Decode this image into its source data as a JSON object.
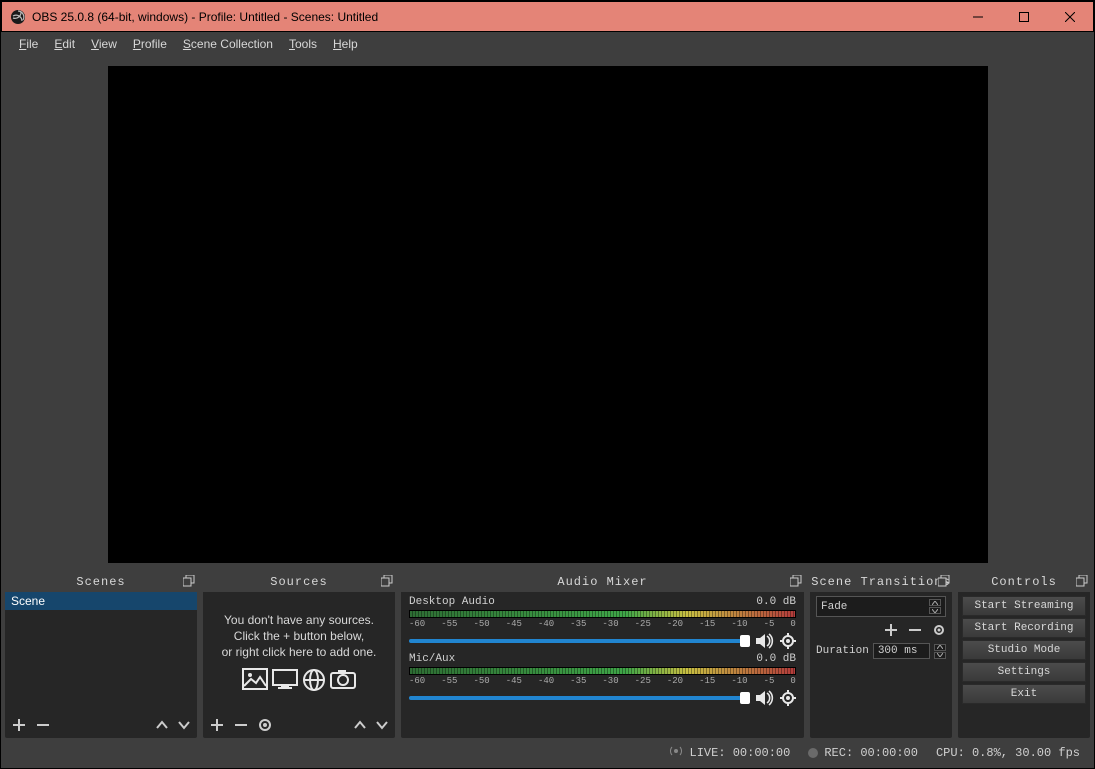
{
  "window": {
    "title": "OBS 25.0.8 (64-bit, windows) - Profile: Untitled - Scenes: Untitled"
  },
  "menubar": {
    "file": "File",
    "edit": "Edit",
    "view": "View",
    "profile": "Profile",
    "scene_collection": "Scene Collection",
    "tools": "Tools",
    "help": "Help"
  },
  "docks": {
    "scenes": {
      "title": "Scenes",
      "items": [
        "Scene"
      ]
    },
    "sources": {
      "title": "Sources",
      "empty_msg_line1": "You don't have any sources.",
      "empty_msg_line2": "Click the + button below,",
      "empty_msg_line3": "or right click here to add one."
    },
    "mixer": {
      "title": "Audio Mixer",
      "ticks": [
        "-60",
        "-55",
        "-50",
        "-45",
        "-40",
        "-35",
        "-30",
        "-25",
        "-20",
        "-15",
        "-10",
        "-5",
        "0"
      ],
      "tracks": [
        {
          "name": "Desktop Audio",
          "level": "0.0 dB"
        },
        {
          "name": "Mic/Aux",
          "level": "0.0 dB"
        }
      ]
    },
    "transitions": {
      "title": "Scene Transitions",
      "selected": "Fade",
      "duration_label": "Duration",
      "duration_value": "300 ms"
    },
    "controls": {
      "title": "Controls",
      "buttons": {
        "start_streaming": "Start Streaming",
        "start_recording": "Start Recording",
        "studio_mode": "Studio Mode",
        "settings": "Settings",
        "exit": "Exit"
      }
    }
  },
  "statusbar": {
    "live": "LIVE: 00:00:00",
    "rec": "REC: 00:00:00",
    "cpu": "CPU: 0.8%, 30.00 fps"
  }
}
